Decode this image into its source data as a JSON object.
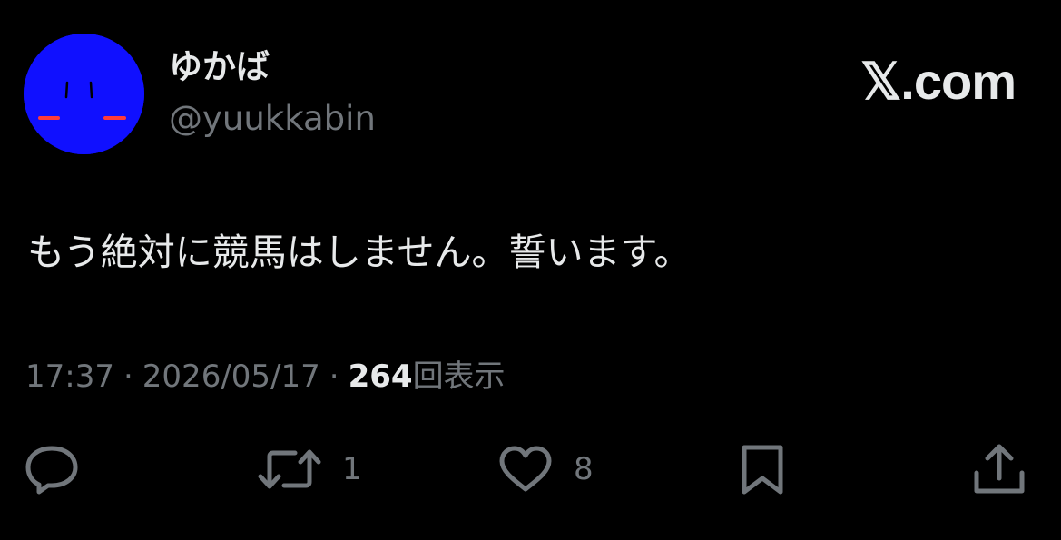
{
  "author": {
    "display_name": "ゆかば",
    "handle": "@yuukkabin",
    "avatar_icon": "avatar-face-icon",
    "avatar_color": "#1010ff"
  },
  "brand": {
    "label": "𝕏.com"
  },
  "tweet": {
    "text": "もう絶対に競馬はしません。誓います。"
  },
  "meta": {
    "time": "17:37",
    "separator": "·",
    "date": "2026/05/17",
    "views_count": "264",
    "views_label": "回表示"
  },
  "actions": {
    "reply": {
      "icon": "reply-icon",
      "count": ""
    },
    "repost": {
      "icon": "repost-icon",
      "count": "1"
    },
    "like": {
      "icon": "heart-icon",
      "count": "8"
    },
    "bookmark": {
      "icon": "bookmark-icon",
      "count": ""
    },
    "share": {
      "icon": "share-icon",
      "count": ""
    }
  },
  "colors": {
    "background": "#000000",
    "primary_text": "#e7e9ea",
    "secondary_text": "#71767b"
  }
}
